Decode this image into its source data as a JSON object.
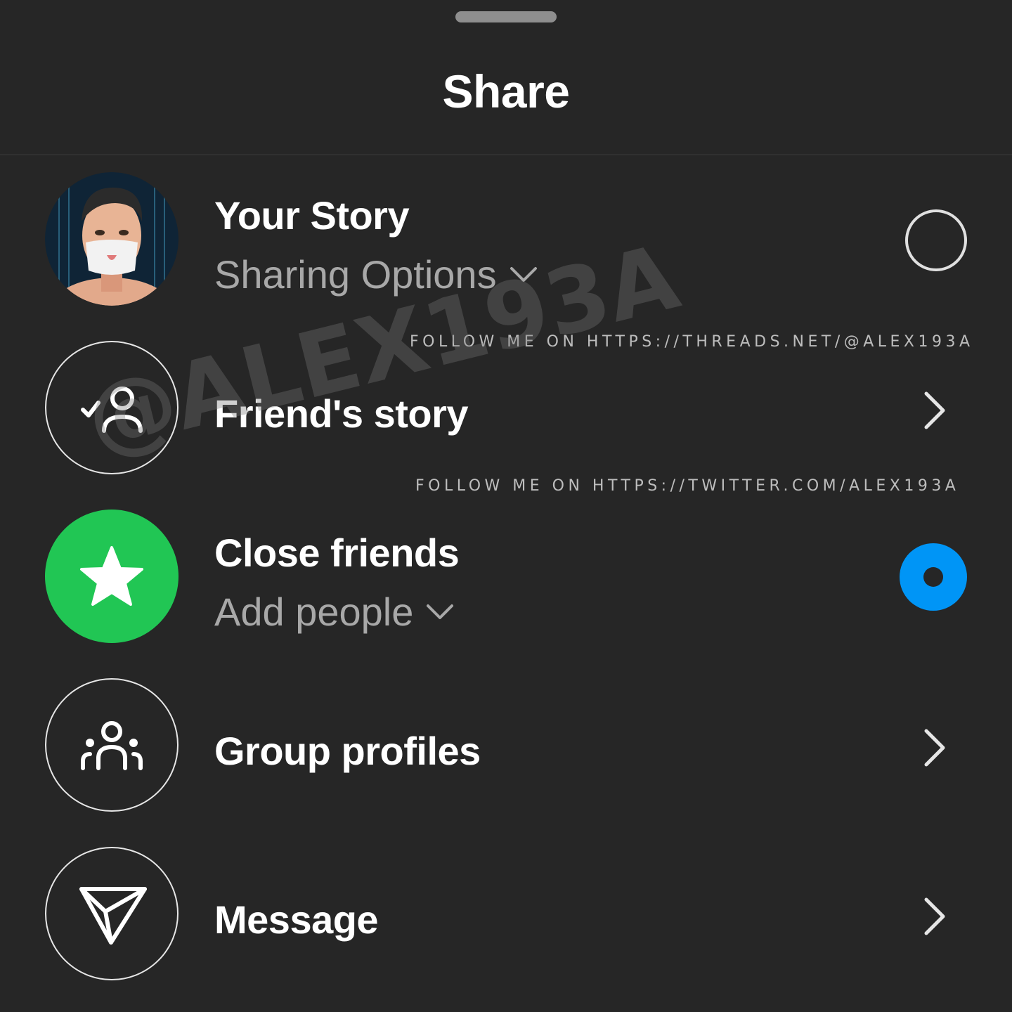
{
  "sheet": {
    "title": "Share"
  },
  "options": {
    "your_story": {
      "label": "Your Story",
      "sublabel": "Sharing Options",
      "selected": false
    },
    "friends_story": {
      "label": "Friend's story"
    },
    "close_friends": {
      "label": "Close friends",
      "sublabel": "Add people",
      "selected": true,
      "icon_color": "#21c654"
    },
    "group_profiles": {
      "label": "Group profiles"
    },
    "message": {
      "label": "Message"
    }
  },
  "watermarks": {
    "threads": "FOLLOW ME ON HTTPS://THREADS.NET/@ALEX193A",
    "twitter": "FOLLOW ME ON HTTPS://TWITTER.COM/ALEX193A",
    "handle": "@ALEX193A"
  },
  "colors": {
    "background": "#262626",
    "radio_selected": "#0095f6",
    "close_friends_green": "#21c654"
  }
}
